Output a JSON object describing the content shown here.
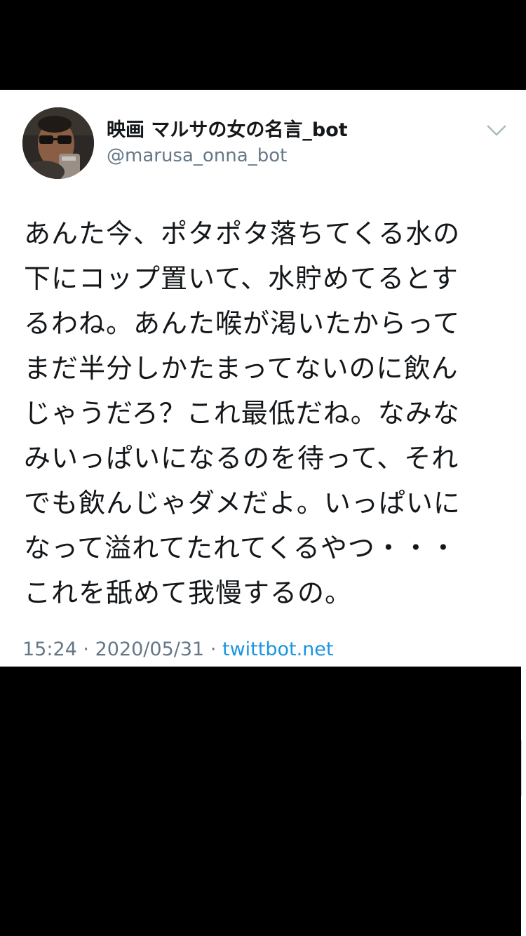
{
  "tweet": {
    "author": {
      "display_name": "映画 マルサの女の名言_bot",
      "handle": "@marusa_onna_bot",
      "avatar_icon": "avatar-photo-man-with-glasses"
    },
    "menu_icon": "chevron-down-icon",
    "text": "あんた今、ポタポタ落ちてくる水の\n下にコップ置いて、水貯めてるとす\nるわね。あんた喉が渇いたからって\nまだ半分しかたまってないのに飲ん\nじゃうだろ？これ最低だね。なみな\nみいっぱいになるのを待って、それ\nでも飲んじゃダメだよ。いっぱいに\nなって溢れてたれてくるやつ・・・\nこれを舐めて我慢するの。",
    "time": "15:24",
    "separator": "·",
    "date": "2020/05/31",
    "source": "twittbot.net"
  },
  "colors": {
    "text_primary": "#14171a",
    "text_secondary": "#657786",
    "link": "#1b95e0",
    "frame": "#000000",
    "card_background": "#ffffff"
  }
}
